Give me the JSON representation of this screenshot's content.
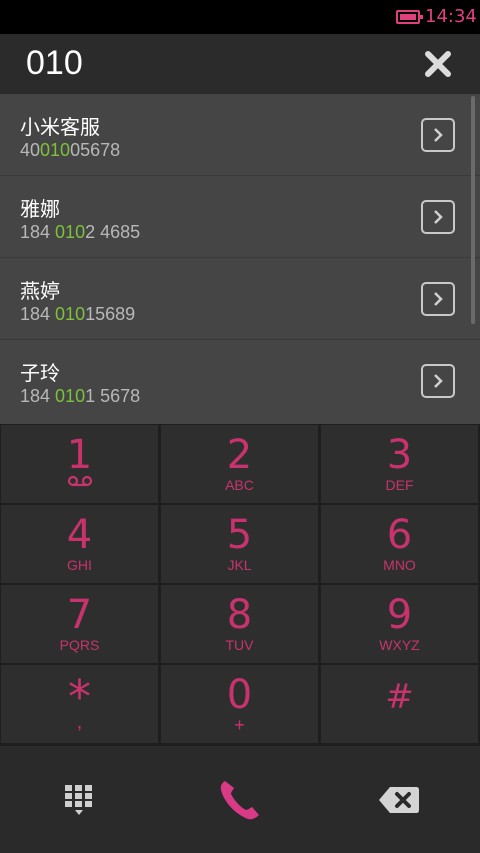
{
  "status_bar": {
    "time": "14:34"
  },
  "dialer": {
    "number": "010"
  },
  "contacts": [
    {
      "name": "小米客服",
      "phone_pre": "40",
      "phone_match": "010",
      "phone_post": "05678"
    },
    {
      "name": "雅娜",
      "phone_pre": "184 ",
      "phone_match": "010",
      "phone_post": "2 4685"
    },
    {
      "name": "燕婷",
      "phone_pre": "184 ",
      "phone_match": "010",
      "phone_post": "15689"
    },
    {
      "name": "子玲",
      "phone_pre": "184 ",
      "phone_match": "010",
      "phone_post": "1 5678"
    }
  ],
  "keypad": [
    {
      "digit": "1",
      "letters": ""
    },
    {
      "digit": "2",
      "letters": "ABC"
    },
    {
      "digit": "3",
      "letters": "DEF"
    },
    {
      "digit": "4",
      "letters": "GHI"
    },
    {
      "digit": "5",
      "letters": "JKL"
    },
    {
      "digit": "6",
      "letters": "MNO"
    },
    {
      "digit": "7",
      "letters": "PQRS"
    },
    {
      "digit": "8",
      "letters": "TUV"
    },
    {
      "digit": "9",
      "letters": "WXYZ"
    },
    {
      "digit": "*",
      "letters": ","
    },
    {
      "digit": "0",
      "letters": "+"
    },
    {
      "digit": "#",
      "letters": ""
    }
  ],
  "colors": {
    "accent": "#c8336e",
    "match": "#7cc23a",
    "status": "#e0407e"
  },
  "icons": {
    "clear": "close-icon",
    "detail": "chevron-right-icon",
    "voicemail": "voicemail-icon",
    "keypad_toggle": "keypad-icon",
    "call": "phone-icon",
    "backspace": "backspace-icon"
  }
}
